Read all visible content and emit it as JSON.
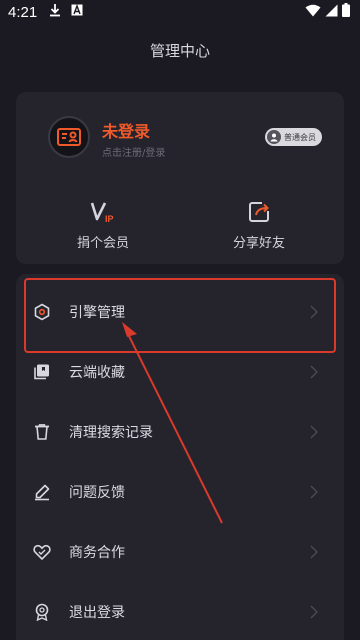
{
  "status_bar": {
    "time": "4:21",
    "icons": [
      "download-icon",
      "text-a-icon",
      "wifi-icon",
      "signal-icon",
      "battery-icon"
    ]
  },
  "header": {
    "title": "管理中心"
  },
  "profile": {
    "title": "未登录",
    "subtitle": "点击注册/登录",
    "badge": "普通会员"
  },
  "quick_actions": [
    {
      "label": "捐个会员",
      "icon": "vip-icon"
    },
    {
      "label": "分享好友",
      "icon": "share-icon"
    }
  ],
  "menu": {
    "items": [
      {
        "label": "引擎管理",
        "icon": "hexagon-settings-icon"
      },
      {
        "label": "云端收藏",
        "icon": "cloud-collection-icon"
      },
      {
        "label": "清理搜索记录",
        "icon": "trash-icon"
      },
      {
        "label": "问题反馈",
        "icon": "pencil-icon"
      },
      {
        "label": "商务合作",
        "icon": "handshake-heart-icon"
      },
      {
        "label": "退出登录",
        "icon": "logout-badge-icon"
      }
    ]
  },
  "colors": {
    "background": "#1b1a22",
    "card": "#25242d",
    "accent": "#f0592a",
    "annotation": "#d93a2c"
  }
}
